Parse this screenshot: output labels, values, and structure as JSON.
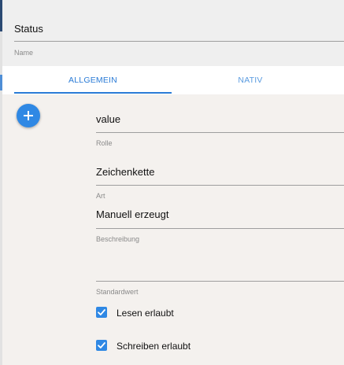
{
  "header": {
    "name_value": "Status",
    "name_label": "Name"
  },
  "tabs": [
    {
      "label": "ALLGEMEIN",
      "active": true
    },
    {
      "label": "NATIV",
      "active": false
    }
  ],
  "form": {
    "role": {
      "value": "value",
      "label": "Rolle"
    },
    "type": {
      "value": "Zeichenkette",
      "label": "Art"
    },
    "description": {
      "value": "Manuell erzeugt",
      "label": "Beschreibung"
    },
    "default_value": {
      "value": "",
      "label": "Standardwert"
    }
  },
  "checkboxes": [
    {
      "label": "Lesen erlaubt",
      "checked": true
    },
    {
      "label": "Schreiben erlaubt",
      "checked": true
    }
  ],
  "fab": {
    "icon": "plus-icon"
  },
  "colors": {
    "accent": "#2f88e4",
    "tab_active": "#2a7bd6",
    "panel_bg": "#f4f1ee"
  }
}
